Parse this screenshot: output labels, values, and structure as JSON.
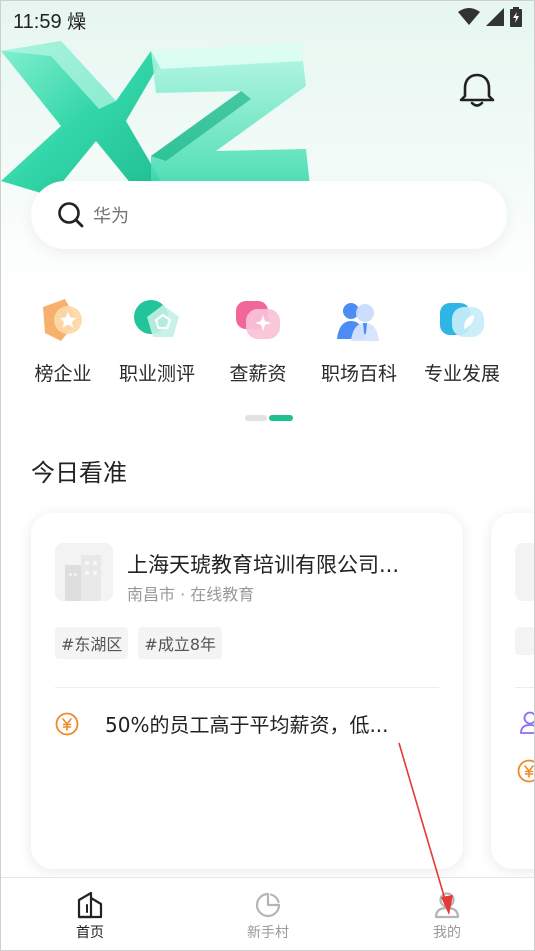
{
  "status_bar": {
    "time": "11:59",
    "extra_glyph": "燥",
    "icons": [
      "wifi-icon",
      "signal-icon",
      "battery-charging-icon"
    ]
  },
  "header": {
    "notification_icon": "bell-icon"
  },
  "search": {
    "placeholder": "华为",
    "icon": "search-icon"
  },
  "categories": [
    {
      "label": "榜企业",
      "icon": "ranking-medal-icon",
      "color": "#f5a35a"
    },
    {
      "label": "职业测评",
      "icon": "assessment-pentagon-icon",
      "color": "#28c79c"
    },
    {
      "label": "查薪资",
      "icon": "salary-chat-icon",
      "color": "#f2679a"
    },
    {
      "label": "职场百科",
      "icon": "people-encyclopedia-icon",
      "color": "#4d8cf5"
    },
    {
      "label": "专业发展",
      "icon": "development-leaf-icon",
      "color": "#2fb4e6"
    }
  ],
  "pager": {
    "pages": 2,
    "active": 2
  },
  "section": {
    "title": "今日看准"
  },
  "cards": [
    {
      "company": "上海天琥教育培训有限公司...",
      "meta": "南昌市 · 在线教育",
      "tags": [
        "#东湖区",
        "#成立8年"
      ],
      "insight": "50%的员工高于平均薪资，低..."
    }
  ],
  "bottom_nav": [
    {
      "label": "首页",
      "icon": "home-icon",
      "active": true
    },
    {
      "label": "新手村",
      "icon": "newbie-village-icon",
      "active": false
    },
    {
      "label": "我的",
      "icon": "profile-icon",
      "active": false
    }
  ],
  "colors": {
    "accent": "#1fbf94",
    "salary_orange": "#f08a24",
    "annotation_arrow": "#e53935"
  }
}
